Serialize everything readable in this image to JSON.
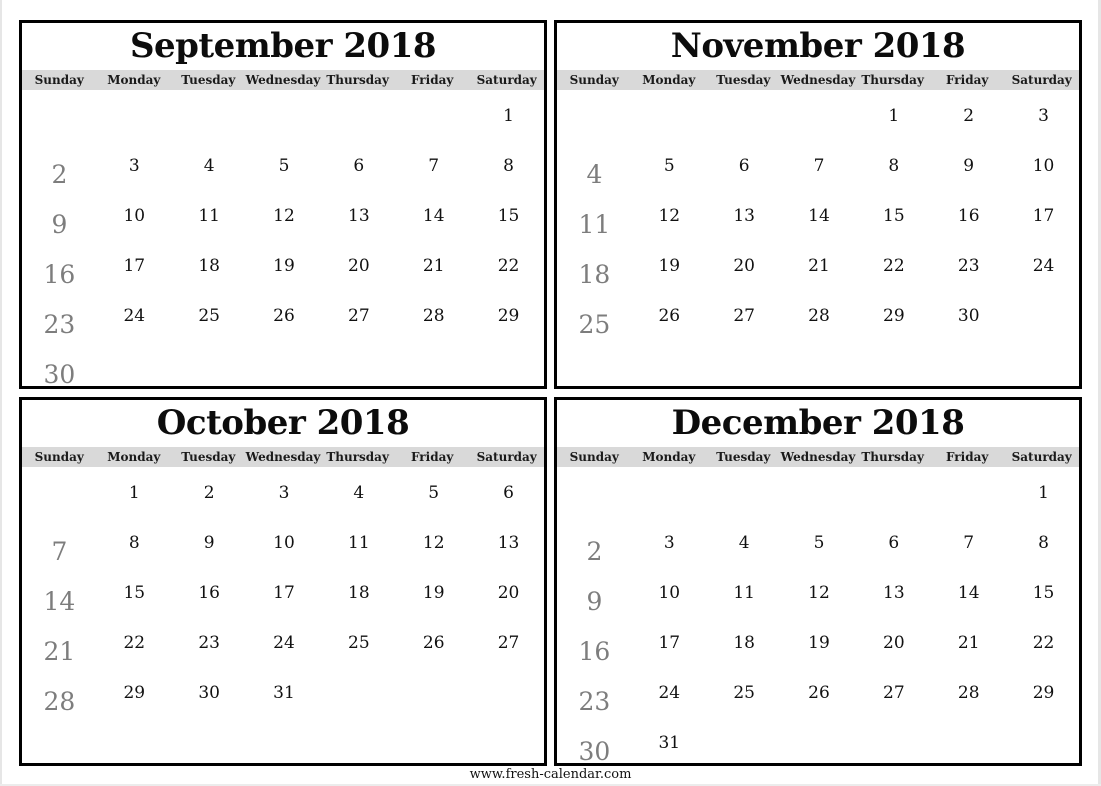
{
  "weekdays": [
    "Sunday",
    "Monday",
    "Tuesday",
    "Wednesday",
    "Thursday",
    "Friday",
    "Saturday"
  ],
  "months": [
    {
      "title": "September 2018",
      "weeks": [
        [
          "",
          "",
          "",
          "",
          "",
          "",
          "1"
        ],
        [
          "2",
          "3",
          "4",
          "5",
          "6",
          "7",
          "8"
        ],
        [
          "9",
          "10",
          "11",
          "12",
          "13",
          "14",
          "15"
        ],
        [
          "16",
          "17",
          "18",
          "19",
          "20",
          "21",
          "22"
        ],
        [
          "23",
          "24",
          "25",
          "26",
          "27",
          "28",
          "29"
        ],
        [
          "30",
          "",
          "",
          "",
          "",
          "",
          ""
        ]
      ]
    },
    {
      "title": "November 2018",
      "weeks": [
        [
          "",
          "",
          "",
          "",
          "1",
          "2",
          "3"
        ],
        [
          "4",
          "5",
          "6",
          "7",
          "8",
          "9",
          "10"
        ],
        [
          "11",
          "12",
          "13",
          "14",
          "15",
          "16",
          "17"
        ],
        [
          "18",
          "19",
          "20",
          "21",
          "22",
          "23",
          "24"
        ],
        [
          "25",
          "26",
          "27",
          "28",
          "29",
          "30",
          ""
        ]
      ]
    },
    {
      "title": "October 2018",
      "weeks": [
        [
          "",
          "1",
          "2",
          "3",
          "4",
          "5",
          "6"
        ],
        [
          "7",
          "8",
          "9",
          "10",
          "11",
          "12",
          "13"
        ],
        [
          "14",
          "15",
          "16",
          "17",
          "18",
          "19",
          "20"
        ],
        [
          "21",
          "22",
          "23",
          "24",
          "25",
          "26",
          "27"
        ],
        [
          "28",
          "29",
          "30",
          "31",
          "",
          "",
          ""
        ]
      ]
    },
    {
      "title": "December 2018",
      "weeks": [
        [
          "",
          "",
          "",
          "",
          "",
          "",
          "1"
        ],
        [
          "2",
          "3",
          "4",
          "5",
          "6",
          "7",
          "8"
        ],
        [
          "9",
          "10",
          "11",
          "12",
          "13",
          "14",
          "15"
        ],
        [
          "16",
          "17",
          "18",
          "19",
          "20",
          "21",
          "22"
        ],
        [
          "23",
          "24",
          "25",
          "26",
          "27",
          "28",
          "29"
        ],
        [
          "30",
          "31",
          "",
          "",
          "",
          "",
          ""
        ]
      ]
    }
  ],
  "footer": {
    "url_text": "www.fresh-calendar.com"
  },
  "colors": {
    "sunday_text": "#7d7d7d",
    "weekday_text": "#111111",
    "header_bar": "#d9d9d9",
    "border": "#000000"
  }
}
